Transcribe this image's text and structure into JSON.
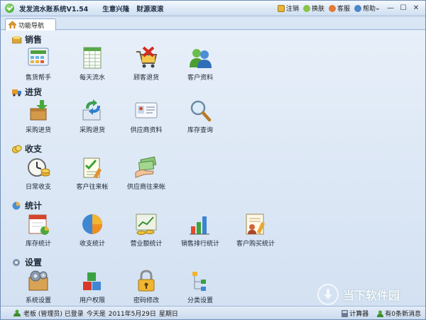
{
  "titlebar": {
    "title": "发发流水账系统V1.54",
    "slogan1": "生意兴隆",
    "slogan2": "财源滚滚",
    "actions": [
      "注销",
      "换肤",
      "客服",
      "帮助"
    ],
    "window_buttons": [
      "⌄",
      "—",
      "☐",
      "✕"
    ]
  },
  "tab": {
    "label": "功能导航"
  },
  "sections": {
    "sales": {
      "title": "销售",
      "items": [
        "售货帮手",
        "每天流水",
        "顾客退货",
        "客户资料"
      ]
    },
    "purchase": {
      "title": "进货",
      "items": [
        "采购进货",
        "采购退货",
        "供应商资料",
        "库存查询"
      ]
    },
    "finance": {
      "title": "收支",
      "items": [
        "日常收支",
        "客户往来帐",
        "供应商往来帐"
      ]
    },
    "stats": {
      "title": "统计",
      "items": [
        "库存统计",
        "收支统计",
        "营业额统计",
        "销售排行统计",
        "客户购买统计"
      ]
    },
    "settings": {
      "title": "设置",
      "items": [
        "系统设置",
        "用户权限",
        "密码修改",
        "分类设置"
      ]
    }
  },
  "status": {
    "user": "老板 (管理员) 已登录",
    "today_label": "今天是",
    "date": "2011年5月29日",
    "weekday": "星期日",
    "calculator": "计算器",
    "messages": "有0条新消息"
  },
  "watermark": {
    "text": "当下软件园",
    "sub": "www.downxia.com"
  }
}
